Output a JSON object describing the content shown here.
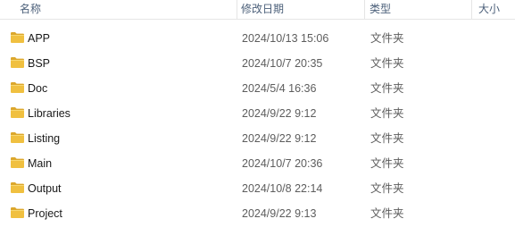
{
  "header": {
    "name": "名称",
    "date_modified": "修改日期",
    "type": "类型",
    "size": "大小",
    "sort_indicator": "^"
  },
  "icons": {
    "folder": "folder-icon",
    "folder_color": "#f0c040",
    "folder_dark": "#dca72c"
  },
  "files": [
    {
      "name": "APP",
      "date": "2024/10/13 15:06",
      "type": "文件夹"
    },
    {
      "name": "BSP",
      "date": "2024/10/7 20:35",
      "type": "文件夹"
    },
    {
      "name": "Doc",
      "date": "2024/5/4 16:36",
      "type": "文件夹"
    },
    {
      "name": "Libraries",
      "date": "2024/9/22 9:12",
      "type": "文件夹"
    },
    {
      "name": "Listing",
      "date": "2024/9/22 9:12",
      "type": "文件夹"
    },
    {
      "name": "Main",
      "date": "2024/10/7 20:36",
      "type": "文件夹"
    },
    {
      "name": "Output",
      "date": "2024/10/8 22:14",
      "type": "文件夹"
    },
    {
      "name": "Project",
      "date": "2024/9/22 9:13",
      "type": "文件夹"
    }
  ]
}
